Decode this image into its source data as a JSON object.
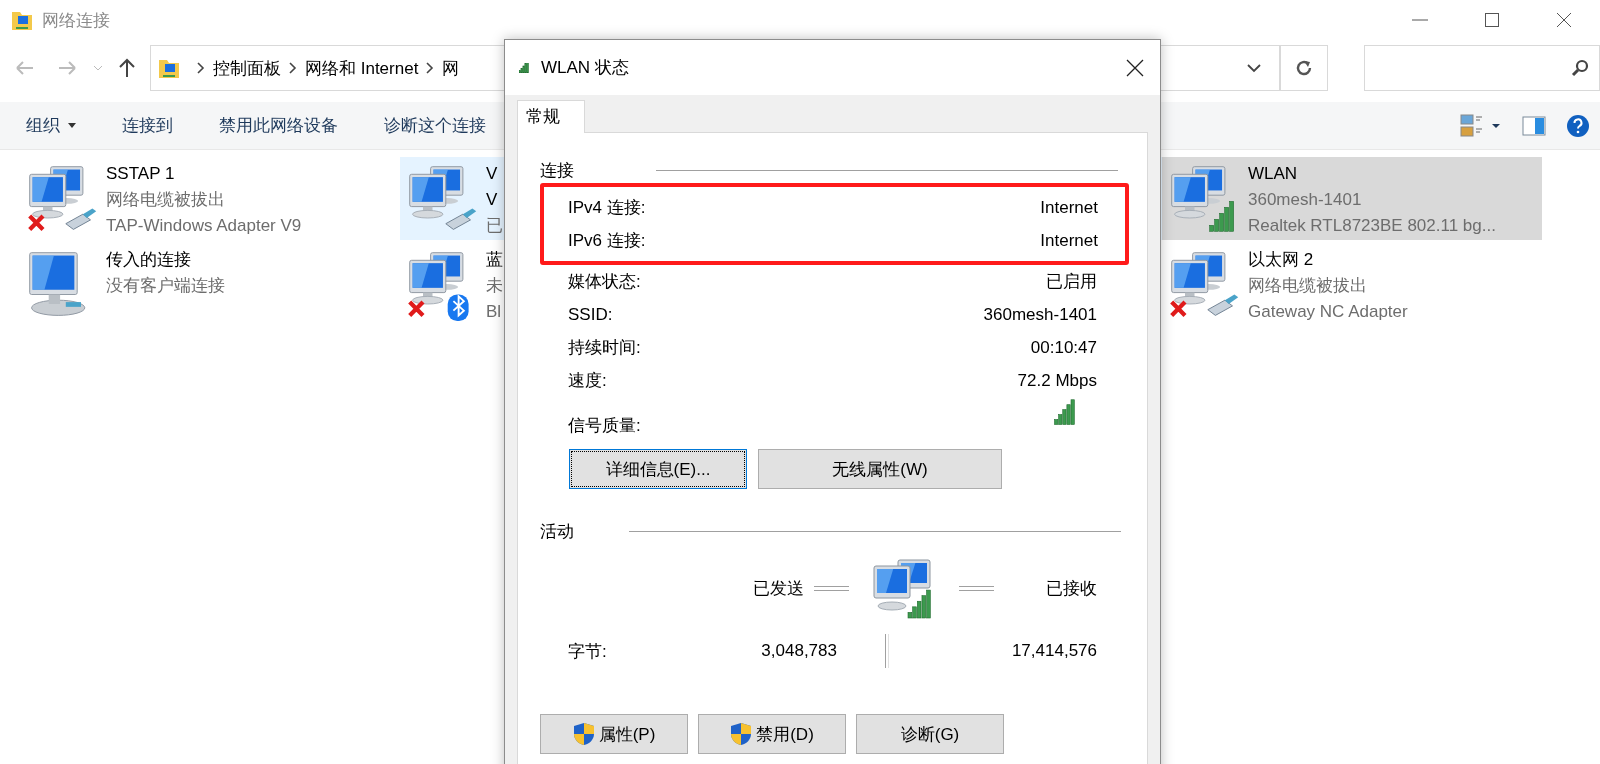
{
  "window": {
    "title": "网络连接"
  },
  "address_bar": {
    "path": [
      "控制面板",
      "网络和 Internet",
      "网"
    ]
  },
  "toolbar": [
    {
      "label": "组织",
      "dropdown": true
    },
    {
      "label": "连接到",
      "dropdown": false
    },
    {
      "label": "禁用此网络设备",
      "dropdown": false
    },
    {
      "label": "诊断这个连接",
      "dropdown": false
    }
  ],
  "connections": [
    {
      "kind": "cable_unplugged",
      "name_lines": [
        "SSTAP 1"
      ],
      "detail_lines": [
        "网络电缆被拔出",
        "TAP-Windows Adapter V9"
      ],
      "selected": false,
      "hovered": false
    },
    {
      "kind": "cable",
      "name_lines": [
        "V",
        "V"
      ],
      "detail_lines": [
        "已"
      ],
      "selected": false,
      "hovered": true
    },
    {
      "kind": "wifi",
      "name_lines": [
        "WLAN"
      ],
      "detail_lines": [
        "360mesh-1401",
        "Realtek RTL8723BE 802.11 bg..."
      ],
      "selected": true,
      "hovered": false
    },
    {
      "kind": "incoming",
      "name_lines": [
        "传入的连接"
      ],
      "detail_lines": [
        "没有客户端连接"
      ],
      "selected": false,
      "hovered": false
    },
    {
      "kind": "bluetooth_off",
      "name_lines": [
        "蓝"
      ],
      "detail_lines": [
        "未",
        "Bl"
      ],
      "selected": false,
      "hovered": false
    },
    {
      "kind": "cable_unplugged",
      "name_lines": [
        "以太网 2"
      ],
      "detail_lines": [
        "网络电缆被拔出",
        "Gateway NC Adapter"
      ],
      "selected": false,
      "hovered": false
    }
  ],
  "dialog": {
    "title": "WLAN 状态",
    "tabs": [
      {
        "label": "常规",
        "selected": true
      }
    ],
    "connection": {
      "title": "连接",
      "rows": [
        {
          "label": "IPv4 连接:",
          "value": "Internet",
          "highlighted": true
        },
        {
          "label": "IPv6 连接:",
          "value": "Internet",
          "highlighted": true
        },
        {
          "label": "媒体状态:",
          "value": "已启用",
          "highlighted": false
        },
        {
          "label": "SSID:",
          "value": "360mesh-1401",
          "highlighted": false
        },
        {
          "label": "持续时间:",
          "value": "00:10:47",
          "highlighted": false
        },
        {
          "label": "速度:",
          "value": "72.2 Mbps",
          "highlighted": false
        }
      ],
      "signal_label": "信号质量:",
      "buttons": [
        {
          "label": "详细信息(E)...",
          "focused": true
        },
        {
          "label": "无线属性(W)",
          "focused": false
        }
      ]
    },
    "activity": {
      "title": "活动",
      "sent_label": "已发送",
      "received_label": "已接收",
      "bytes_label": "字节:",
      "bytes_sent": "3,048,783",
      "bytes_received": "17,414,576"
    },
    "buttons": [
      {
        "label": "属性(P)",
        "shield": true
      },
      {
        "label": "禁用(D)",
        "shield": true
      },
      {
        "label": "诊断(G)",
        "shield": false
      }
    ]
  }
}
